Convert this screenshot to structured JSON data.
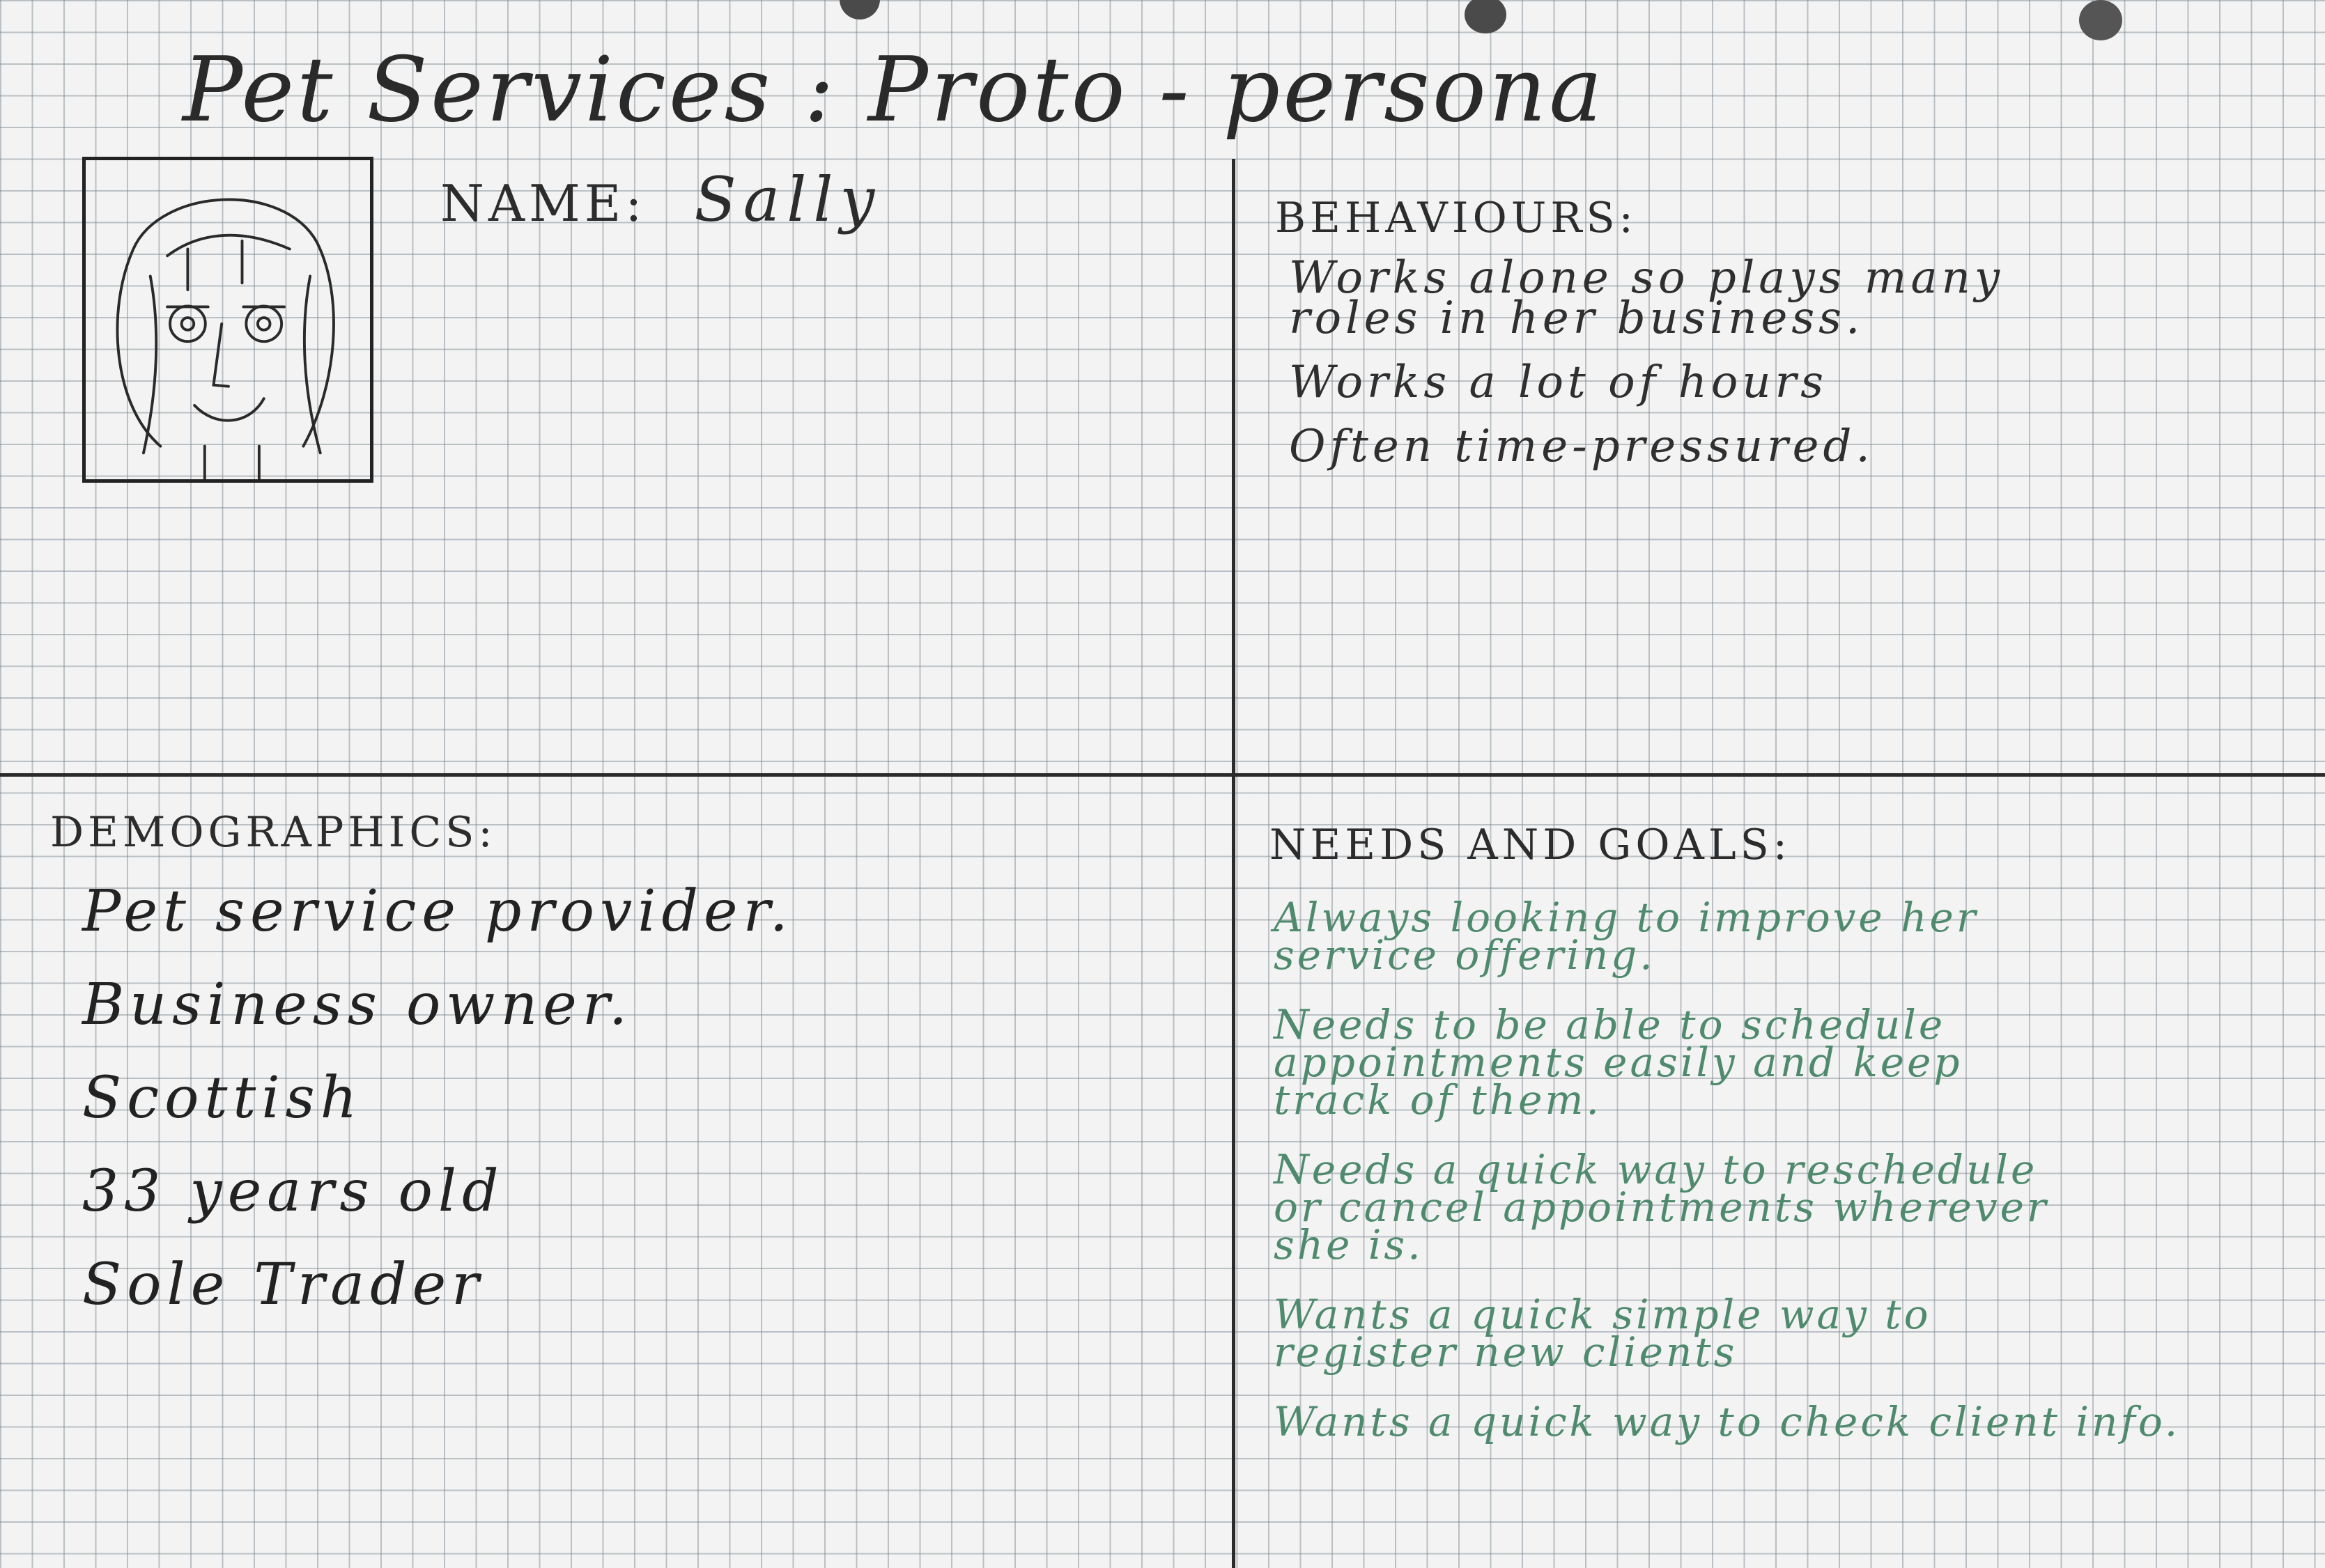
{
  "title": "Pet Services : Proto - persona",
  "profile": {
    "name_label": "NAME:",
    "name_value": "Sally"
  },
  "behaviours": {
    "heading": "BEHAVIOURS:",
    "items": [
      "Works alone so plays many\nroles in her business.",
      "Works a lot of hours",
      "Often time-pressured."
    ]
  },
  "demographics": {
    "heading": "DEMOGRAPHICS:",
    "items": [
      "Pet service provider.",
      "Business owner.",
      "Scottish",
      "33 years old",
      "Sole Trader"
    ]
  },
  "needs_goals": {
    "heading": "NEEDS AND GOALS:",
    "items": [
      "Always looking to improve her\nservice offering.",
      "Needs to be able to schedule\nappointments easily and keep\ntrack of them.",
      "Needs a quick way to reschedule\nor cancel appointments wherever\nshe is.",
      "Wants a quick simple way to\nregister new clients",
      "Wants a quick way to check client info."
    ]
  },
  "colors": {
    "pen_black": "#2c2c2c",
    "pen_green": "#4f8a6e",
    "paper": "#f2f3f2",
    "grid": "#78828c"
  }
}
